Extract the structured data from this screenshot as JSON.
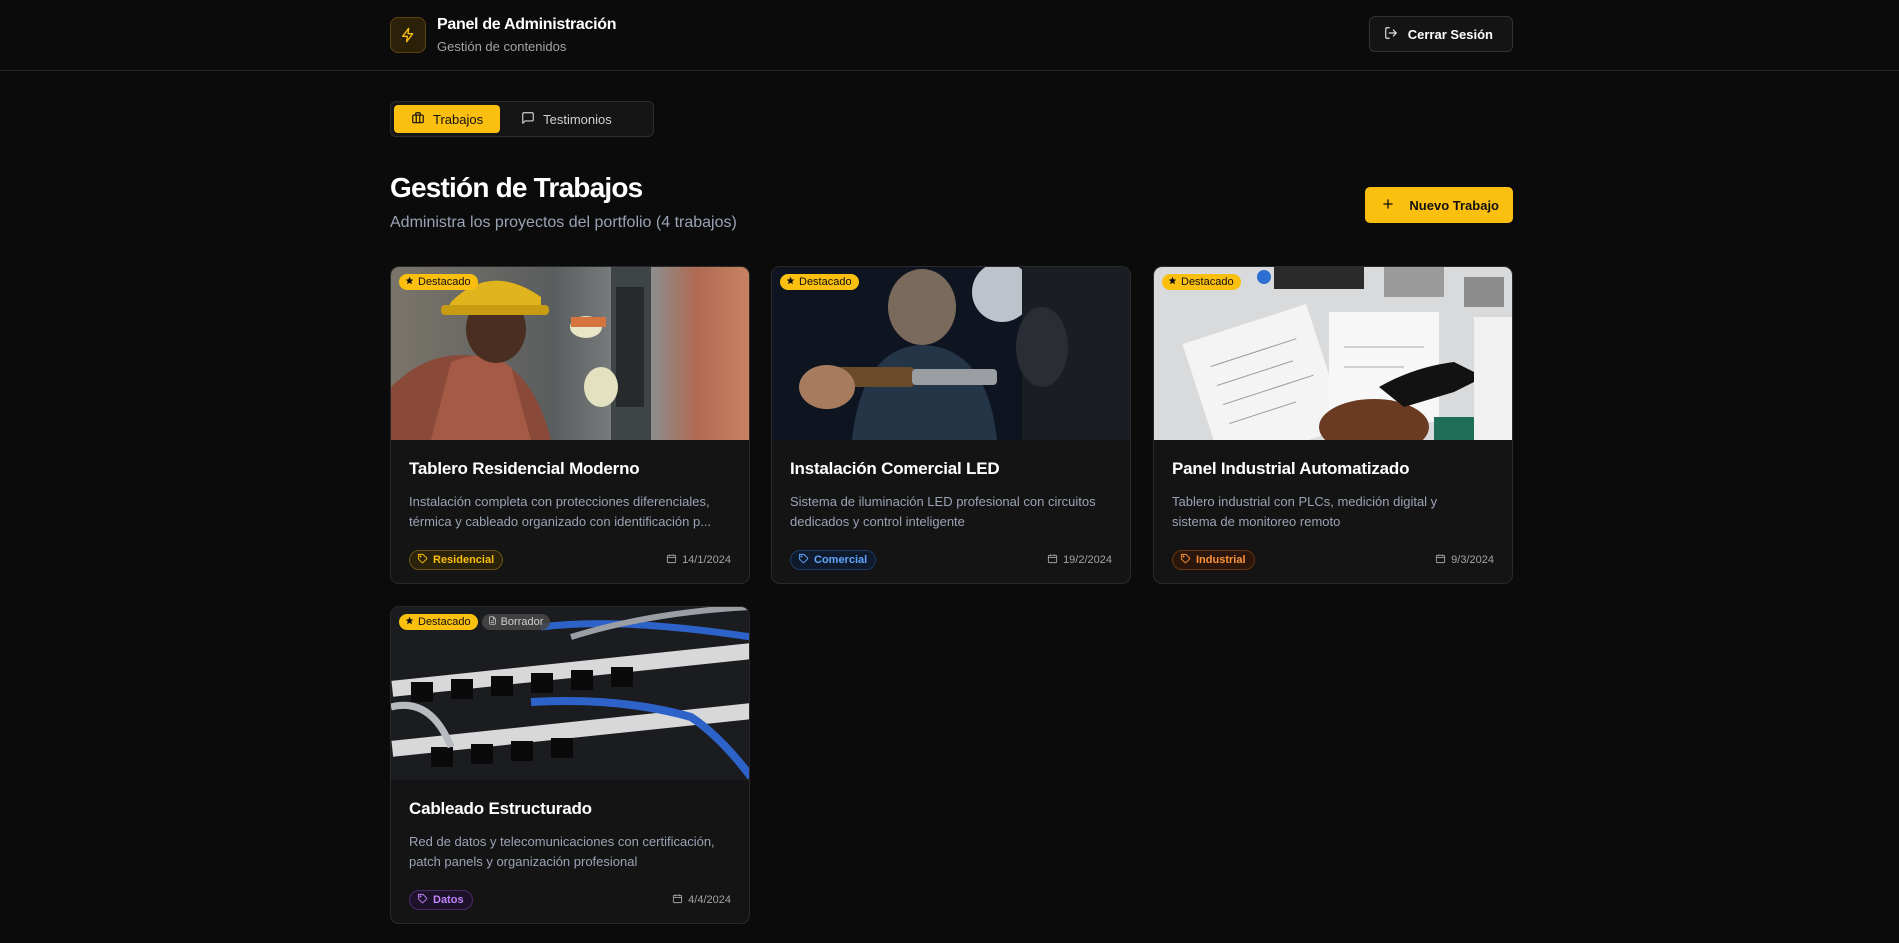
{
  "header": {
    "title": "Panel de Administración",
    "subtitle": "Gestión de contenidos",
    "logout_label": "Cerrar Sesión"
  },
  "tabs": [
    {
      "label": "Trabajos",
      "active": true
    },
    {
      "label": "Testimonios",
      "active": false
    }
  ],
  "section": {
    "title": "Gestión de Trabajos",
    "subtitle": "Administra los proyectos del portfolio (4 trabajos)",
    "new_button_label": "Nuevo Trabajo"
  },
  "colors": {
    "accent": "#fbbf0f",
    "tag_residencial": "#fbbf0f",
    "tag_comercial": "#60a5fa",
    "tag_industrial": "#fb923c",
    "tag_datos": "#c084fc"
  },
  "projects": [
    {
      "title": "Tablero Residencial Moderno",
      "desc_line1": "Instalación completa con protecciones diferenciales,",
      "desc_line2": "térmica y cableado organizado con identificación p...",
      "category": "Residencial",
      "date": "14/1/2024",
      "featured_label": "Destacado"
    },
    {
      "title": "Instalación Comercial LED",
      "desc_line1": "Sistema de iluminación LED profesional con circuitos",
      "desc_line2": "dedicados y control inteligente",
      "category": "Comercial",
      "date": "19/2/2024",
      "featured_label": "Destacado"
    },
    {
      "title": "Panel Industrial Automatizado",
      "desc_line1": "Tablero industrial con PLCs, medición digital y",
      "desc_line2": "sistema de monitoreo remoto",
      "category": "Industrial",
      "date": "9/3/2024",
      "featured_label": "Destacado"
    },
    {
      "title": "Cableado Estructurado",
      "desc_line1": "Red de datos y telecomunicaciones con certificación,",
      "desc_line2": "patch panels y organización profesional",
      "category": "Datos",
      "date": "4/4/2024",
      "featured_label": "Destacado",
      "draft_label": "Borrador"
    }
  ]
}
